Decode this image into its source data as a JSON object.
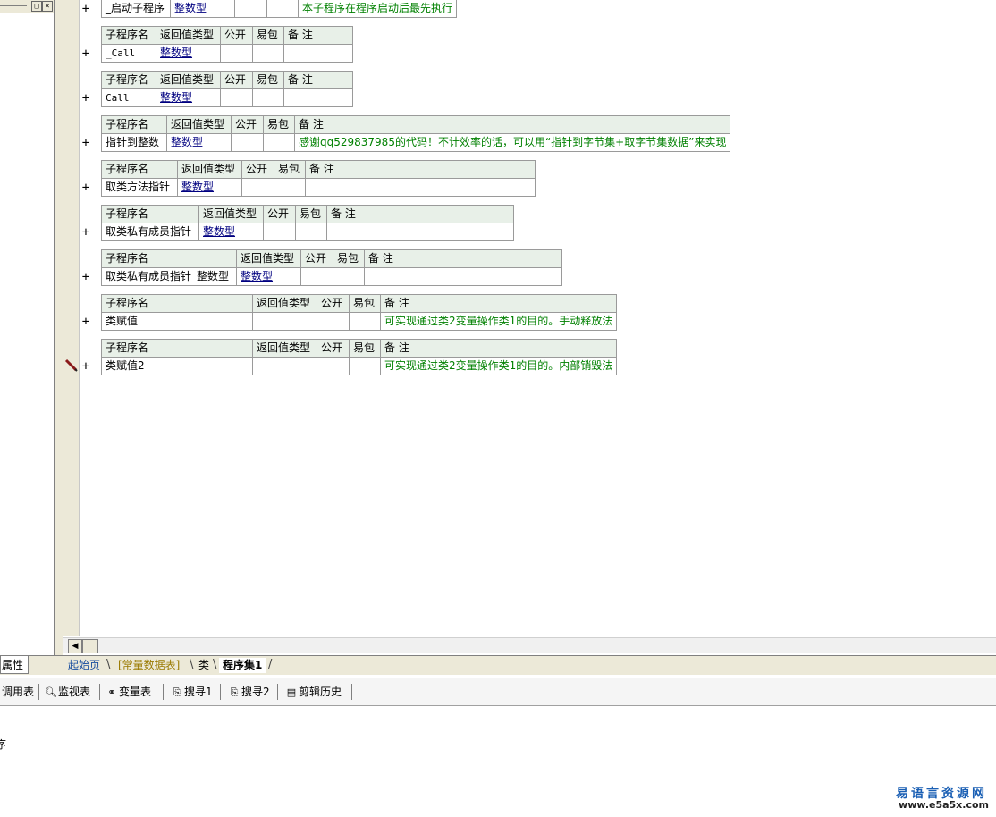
{
  "headers": {
    "name": "子程序名",
    "ret": "返回值类型",
    "pub": "公开",
    "easy": "易包",
    "note": "备 注"
  },
  "subs": [
    {
      "name": "_启动子程序",
      "ret": "整数型",
      "note": "本子程序在程序启动后最先执行"
    },
    {
      "name": "_Call",
      "ret": "整数型",
      "note": ""
    },
    {
      "name": "Call",
      "ret": "整数型",
      "note": ""
    },
    {
      "name": "指针到整数",
      "ret": "整数型",
      "note": "感谢qq529837985的代码！不计效率的话，可以用“指针到字节集+取字节集数据”来实现"
    },
    {
      "name": "取类方法指针",
      "ret": "整数型",
      "note": ""
    },
    {
      "name": "取类私有成员指针",
      "ret": "整数型",
      "note": ""
    },
    {
      "name": "取类私有成员指针_整数型",
      "ret": "整数型",
      "note": ""
    },
    {
      "name": "类赋值",
      "ret": "",
      "note": "可实现通过类2变量操作类1的目的。手动释放法"
    },
    {
      "name": "类赋值2",
      "ret": "",
      "note": "可实现通过类2变量操作类1的目的。内部销毁法"
    }
  ],
  "expand_symbol": "+",
  "left_panel": {
    "tab_label": "属性",
    "btn_restore": "□",
    "btn_close": "×"
  },
  "tabs": [
    "起始页",
    "[常量数据表]",
    "类",
    "程序集1"
  ],
  "toolbar": [
    {
      "label": "调用表",
      "icon": "call-list-icon"
    },
    {
      "label": "监视表",
      "icon": "magnifier-icon"
    },
    {
      "label": "变量表",
      "icon": "variable-icon"
    },
    {
      "label": "搜寻1",
      "icon": "search-doc-icon"
    },
    {
      "label": "搜寻2",
      "icon": "search-doc-icon"
    },
    {
      "label": "剪辑历史",
      "icon": "clipboard-icon"
    }
  ],
  "output_text": "序",
  "watermark": {
    "cn": "易语言资源网",
    "url": "www.e5a5x.com"
  },
  "colors": {
    "type_link": "#000080",
    "note": "#008000",
    "header_bg": "#e8f0e8"
  }
}
